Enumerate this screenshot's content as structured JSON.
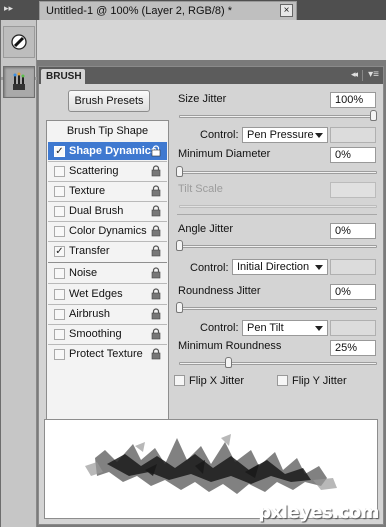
{
  "document": {
    "tab_title": "Untitled-1 @ 100% (Layer 2, RGB/8) *",
    "close_glyph": "×"
  },
  "panel": {
    "tab_label": "BRUSH",
    "collapse_glyph": "◂◂",
    "menu_glyph": "▾≡"
  },
  "brush_presets_label": "Brush Presets",
  "tip_list": {
    "header": "Brush Tip Shape",
    "items": [
      {
        "label": "Shape Dynamics",
        "checked": true,
        "selected": true,
        "locked": true
      },
      {
        "label": "Scattering",
        "checked": false,
        "selected": false,
        "locked": true
      },
      {
        "label": "Texture",
        "checked": false,
        "selected": false,
        "locked": true
      },
      {
        "label": "Dual Brush",
        "checked": false,
        "selected": false,
        "locked": true
      },
      {
        "label": "Color Dynamics",
        "checked": false,
        "selected": false,
        "locked": true
      },
      {
        "label": "Transfer",
        "checked": true,
        "selected": false,
        "locked": true
      },
      {
        "label": "Noise",
        "checked": false,
        "selected": false,
        "locked": true
      },
      {
        "label": "Wet Edges",
        "checked": false,
        "selected": false,
        "locked": true
      },
      {
        "label": "Airbrush",
        "checked": false,
        "selected": false,
        "locked": true
      },
      {
        "label": "Smoothing",
        "checked": false,
        "selected": false,
        "locked": true
      },
      {
        "label": "Protect Texture",
        "checked": false,
        "selected": false,
        "locked": true
      }
    ]
  },
  "settings": {
    "size_jitter": {
      "label": "Size Jitter",
      "value": "100%",
      "level": 1.0
    },
    "size_control": {
      "label": "Control:",
      "value": "Pen Pressure"
    },
    "minimum_diameter": {
      "label": "Minimum Diameter",
      "value": "0%",
      "level": 0.0
    },
    "tilt_scale": {
      "label": "Tilt Scale",
      "value": ""
    },
    "angle_jitter": {
      "label": "Angle Jitter",
      "value": "0%",
      "level": 0.0
    },
    "angle_control": {
      "label": "Control:",
      "value": "Initial Direction"
    },
    "roundness_jitter": {
      "label": "Roundness Jitter",
      "value": "0%",
      "level": 0.0
    },
    "roundness_control": {
      "label": "Control:",
      "value": "Pen Tilt"
    },
    "minimum_roundness": {
      "label": "Minimum Roundness",
      "value": "25%",
      "level": 0.25
    },
    "flip_x": {
      "label": "Flip X Jitter",
      "checked": false
    },
    "flip_y": {
      "label": "Flip Y Jitter",
      "checked": false
    }
  },
  "watermark": "pxleyes.com",
  "colors": {
    "selection": "#3f79d0",
    "panel_bg": "#d4d4d4",
    "header_bg": "#5c5c5c"
  }
}
